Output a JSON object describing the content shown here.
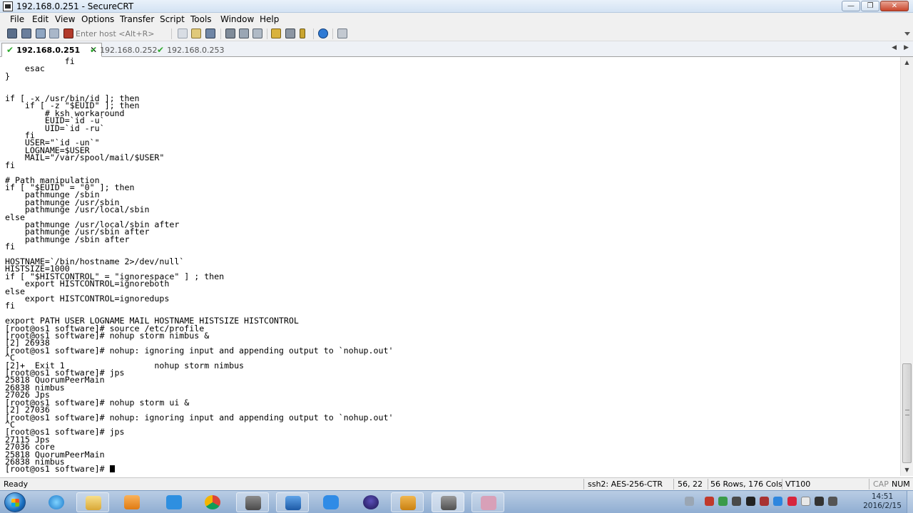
{
  "window": {
    "title": "192.168.0.251 - SecureCRT",
    "buttons": {
      "minimize": "—",
      "maximize": "❐",
      "close": "✕"
    }
  },
  "menu": [
    "File",
    "Edit",
    "View",
    "Options",
    "Transfer",
    "Script",
    "Tools",
    "Window",
    "Help"
  ],
  "toolbar": {
    "host_placeholder": "Enter host <Alt+R>"
  },
  "tabs": [
    {
      "label": "192.168.0.251",
      "active": true
    },
    {
      "label": "192.168.0.252",
      "active": false
    },
    {
      "label": "192.168.0.253",
      "active": false
    }
  ],
  "tab_close": "✕",
  "tab_nav": {
    "prev": "◀",
    "next": "▶"
  },
  "terminal": {
    "lines": [
      "            fi",
      "    esac",
      "}",
      "",
      "",
      "if [ -x /usr/bin/id ]; then",
      "    if [ -z \"$EUID\" ]; then",
      "        # ksh workaround",
      "        EUID=`id -u`",
      "        UID=`id -ru`",
      "    fi",
      "    USER=\"`id -un`\"",
      "    LOGNAME=$USER",
      "    MAIL=\"/var/spool/mail/$USER\"",
      "fi",
      "",
      "# Path manipulation",
      "if [ \"$EUID\" = \"0\" ]; then",
      "    pathmunge /sbin",
      "    pathmunge /usr/sbin",
      "    pathmunge /usr/local/sbin",
      "else",
      "    pathmunge /usr/local/sbin after",
      "    pathmunge /usr/sbin after",
      "    pathmunge /sbin after",
      "fi",
      "",
      "HOSTNAME=`/bin/hostname 2>/dev/null`",
      "HISTSIZE=1000",
      "if [ \"$HISTCONTROL\" = \"ignorespace\" ] ; then",
      "    export HISTCONTROL=ignoreboth",
      "else",
      "    export HISTCONTROL=ignoredups",
      "fi",
      "",
      "export PATH USER LOGNAME MAIL HOSTNAME HISTSIZE HISTCONTROL",
      "[root@os1 software]# source /etc/profile",
      "[root@os1 software]# nohup storm nimbus &",
      "[2] 26938",
      "[root@os1 software]# nohup: ignoring input and appending output to `nohup.out'",
      "^C",
      "[2]+  Exit 1                  nohup storm nimbus",
      "[root@os1 software]# jps",
      "25818 QuorumPeerMain",
      "26838 nimbus",
      "27026 Jps",
      "[root@os1 software]# nohup storm ui &",
      "[2] 27036",
      "[root@os1 software]# nohup: ignoring input and appending output to `nohup.out'",
      "^C",
      "[root@os1 software]# jps",
      "27115 Jps",
      "27036 core",
      "25818 QuorumPeerMain",
      "26838 nimbus",
      "[root@os1 software]# "
    ]
  },
  "scrollbar": {
    "up": "▲",
    "down": "▼"
  },
  "status": {
    "ready": "Ready",
    "cipher": "ssh2: AES-256-CTR",
    "cursor_pos": "56,  22",
    "size": "56 Rows, 176 Cols",
    "emulation": "VT100",
    "caps": "CAP",
    "num": "NUM"
  },
  "taskbar": {
    "clock_time": "14:51",
    "clock_date": "2016/2/15"
  }
}
